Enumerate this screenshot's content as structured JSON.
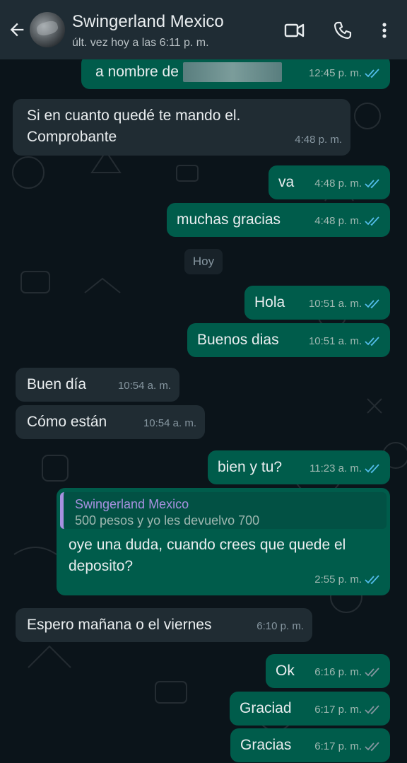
{
  "header": {
    "title": "Swingerland Mexico",
    "subtitle": "últ. vez hoy a las 6:11 p. m.",
    "icons": [
      "back-arrow-icon",
      "avatar",
      "video-call-icon",
      "voice-call-icon",
      "more-options-icon"
    ]
  },
  "colors": {
    "header_bg": "#1f2c34",
    "chat_bg": "#0b141a",
    "out_bubble": "#005c4b",
    "in_bubble": "#202c33",
    "read_ticks": "#53bdeb",
    "sent_ticks": "#8696a0"
  },
  "day_chip": "Hoy",
  "messages": [
    {
      "dir": "out",
      "lines": [
        "a nombre de"
      ],
      "time": "12:45 p. m.",
      "status": "read",
      "redacted": true
    },
    {
      "dir": "in",
      "lines": [
        "Si en cuanto quedé te mando el.",
        "Comprobante"
      ],
      "time": "4:48 p. m."
    },
    {
      "dir": "out",
      "lines": [
        "va"
      ],
      "time": "4:48 p. m.",
      "status": "read"
    },
    {
      "dir": "out",
      "lines": [
        "muchas gracias"
      ],
      "time": "4:48 p. m.",
      "status": "read"
    },
    {
      "dir": "out",
      "lines": [
        "Hola"
      ],
      "time": "10:51 a. m.",
      "status": "read"
    },
    {
      "dir": "out",
      "lines": [
        "Buenos dias"
      ],
      "time": "10:51 a. m.",
      "status": "read"
    },
    {
      "dir": "in",
      "lines": [
        "Buen día"
      ],
      "time": "10:54 a. m."
    },
    {
      "dir": "in",
      "lines": [
        "Cómo están"
      ],
      "time": "10:54 a. m."
    },
    {
      "dir": "out",
      "lines": [
        "bien y tu?"
      ],
      "time": "11:23 a. m.",
      "status": "read"
    },
    {
      "dir": "out",
      "quote": {
        "name": "Swingerland Mexico",
        "text": "500 pesos y yo les devuelvo 700"
      },
      "lines": [
        "oye una duda, cuando crees que quede el",
        "deposito?"
      ],
      "time": "2:55 p. m.",
      "status": "read"
    },
    {
      "dir": "in",
      "lines": [
        "Espero mañana o el viernes"
      ],
      "time": "6:10 p. m."
    },
    {
      "dir": "out",
      "lines": [
        "Ok"
      ],
      "time": "6:16 p. m.",
      "status": "delivered"
    },
    {
      "dir": "out",
      "lines": [
        "Graciad"
      ],
      "time": "6:17 p. m.",
      "status": "delivered"
    },
    {
      "dir": "out",
      "lines": [
        "Gracias"
      ],
      "time": "6:17 p. m.",
      "status": "delivered"
    }
  ]
}
